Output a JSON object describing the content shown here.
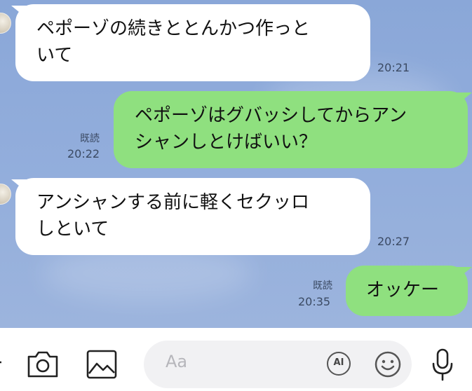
{
  "messages": [
    {
      "side": "in",
      "lines": [
        "ペポーゾの続きととんかつ作っと",
        "いて"
      ],
      "time": "20:21"
    },
    {
      "side": "out",
      "lines": [
        "ペポーゾはグバッシしてからアン",
        "シャンしとけばいい？"
      ],
      "read": "既読",
      "time": "20:22"
    },
    {
      "side": "in",
      "lines": [
        "アンシャンする前に軽くセクッロ",
        "しといて"
      ],
      "time": "20:27"
    },
    {
      "side": "out",
      "lines": [
        "オッケー"
      ],
      "read": "既読",
      "time": "20:35"
    }
  ],
  "input": {
    "placeholder": "Aa",
    "ai_label": "AI"
  },
  "icons": [
    "plus-icon",
    "camera-icon",
    "image-icon",
    "ai-icon",
    "emoji-icon",
    "microphone-icon"
  ]
}
